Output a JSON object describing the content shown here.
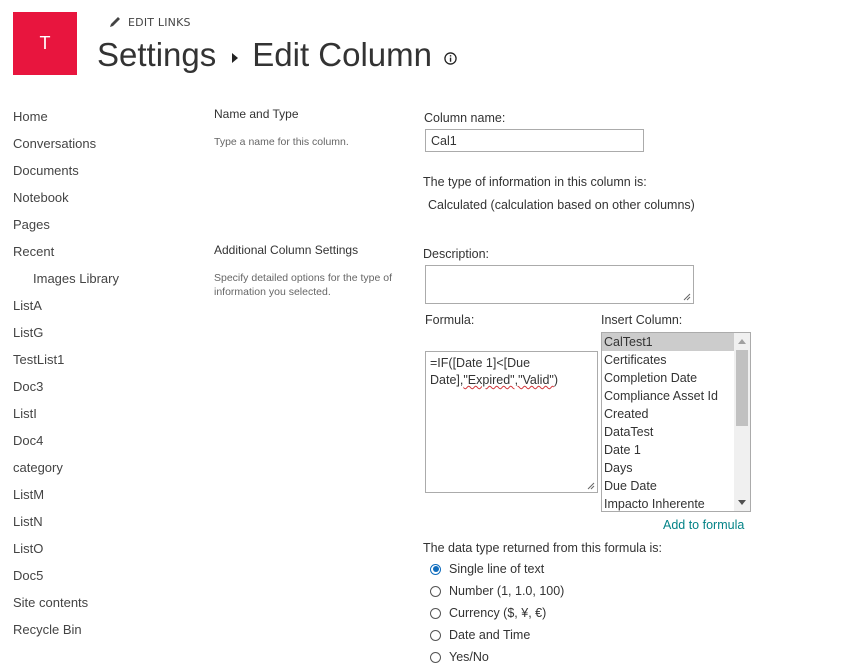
{
  "header": {
    "logo_letter": "T",
    "logo_color": "#e8153e",
    "edit_links_label": "EDIT LINKS",
    "breadcrumb_root": "Settings",
    "breadcrumb_current": "Edit Column"
  },
  "sidebar": {
    "items": [
      {
        "label": "Home"
      },
      {
        "label": "Conversations"
      },
      {
        "label": "Documents"
      },
      {
        "label": "Notebook"
      },
      {
        "label": "Pages"
      },
      {
        "label": "Recent"
      },
      {
        "label": "Images Library",
        "indent": true
      },
      {
        "label": "ListA"
      },
      {
        "label": "ListG"
      },
      {
        "label": "TestList1"
      },
      {
        "label": "Doc3"
      },
      {
        "label": "ListI"
      },
      {
        "label": "Doc4"
      },
      {
        "label": "category"
      },
      {
        "label": "ListM"
      },
      {
        "label": "ListN"
      },
      {
        "label": "ListO"
      },
      {
        "label": "Doc5"
      },
      {
        "label": "Site contents"
      },
      {
        "label": "Recycle Bin"
      }
    ]
  },
  "sections": {
    "name_type": {
      "title": "Name and Type",
      "description": "Type a name for this column."
    },
    "additional": {
      "title": "Additional Column Settings",
      "description": "Specify detailed options for the type of information you selected."
    }
  },
  "form": {
    "column_name_label": "Column name:",
    "column_name_value": "Cal1",
    "type_label": "The type of information in this column is:",
    "type_value": "Calculated (calculation based on other columns)",
    "description_label": "Description:",
    "description_value": "",
    "formula_label": "Formula:",
    "formula_part1": "=IF([Date 1]<[Due Date],",
    "formula_part2": "\"Expired\",\"Valid\"",
    "formula_part3": ")",
    "insert_column_label": "Insert Column:",
    "insert_columns": [
      {
        "label": "CalTest1",
        "selected": true
      },
      {
        "label": "Certificates"
      },
      {
        "label": "Completion Date"
      },
      {
        "label": "Compliance Asset Id"
      },
      {
        "label": "Created"
      },
      {
        "label": "DataTest"
      },
      {
        "label": "Date 1"
      },
      {
        "label": "Days"
      },
      {
        "label": "Due Date"
      },
      {
        "label": "Impacto Inherente"
      }
    ],
    "add_to_formula_label": "Add to formula",
    "link_color": "#038387",
    "return_type_label": "The data type returned from this formula is:",
    "return_types": [
      {
        "label": "Single line of text",
        "checked": true
      },
      {
        "label": "Number (1, 1.0, 100)"
      },
      {
        "label": "Currency ($, ¥, €)"
      },
      {
        "label": "Date and Time"
      },
      {
        "label": "Yes/No"
      }
    ]
  }
}
